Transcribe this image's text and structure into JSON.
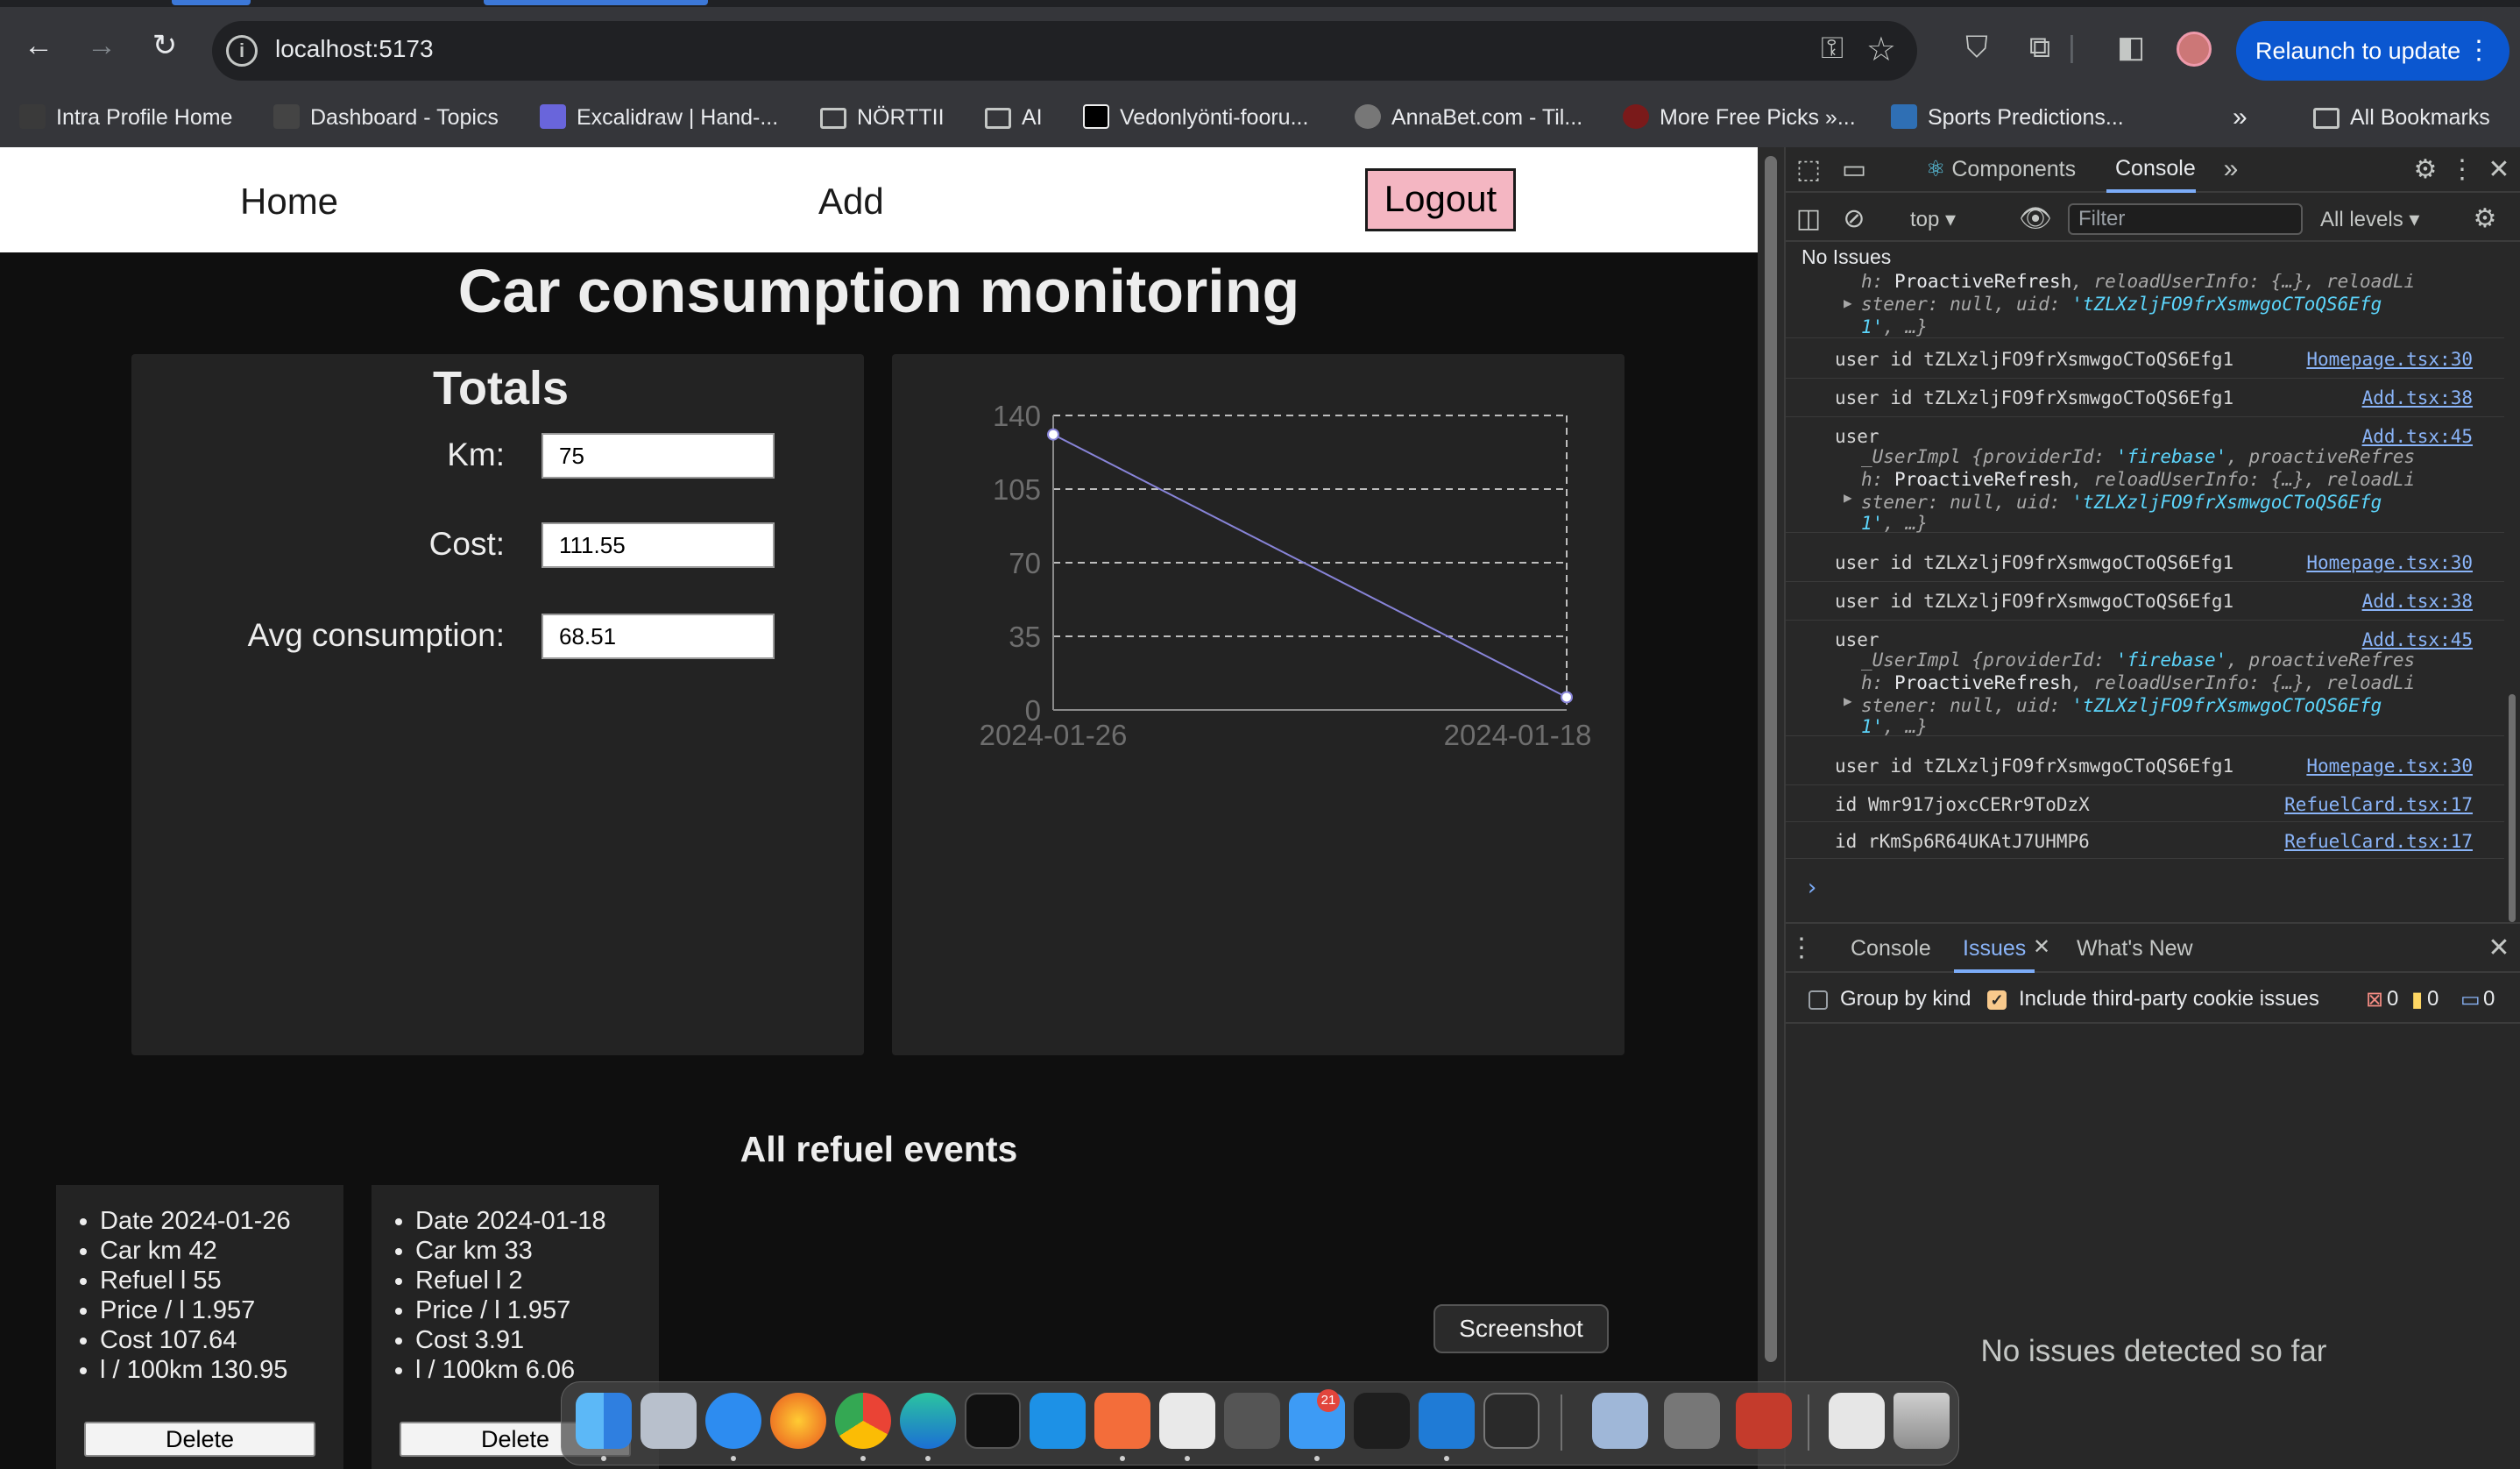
{
  "browser": {
    "url": "localhost:5173",
    "relaunch_label": "Relaunch to update",
    "bookmarks": [
      {
        "label": "Intra Profile Home",
        "icon": "4s-logo-icon"
      },
      {
        "label": "Dashboard - Topics",
        "icon": "forum-icon"
      },
      {
        "label": "Excalidraw | Hand-...",
        "icon": "excalidraw-icon"
      },
      {
        "label": "NÖRTTII",
        "icon": "folder-icon"
      },
      {
        "label": "AI",
        "icon": "folder-icon"
      },
      {
        "label": "Vedonlyönti-fooru...",
        "icon": "terminal-icon"
      },
      {
        "label": "AnnaBet.com - Til...",
        "icon": "annabet-icon"
      },
      {
        "label": "More Free Picks »...",
        "icon": "picks-icon"
      },
      {
        "label": "Sports Predictions...",
        "icon": "predictions-icon"
      }
    ],
    "all_bookmarks_label": "All Bookmarks"
  },
  "app": {
    "nav": {
      "home": "Home",
      "add": "Add",
      "logout": "Logout"
    },
    "title": "Car consumption monitoring",
    "totals": {
      "title": "Totals",
      "km_label": "Km:",
      "km_value": "75",
      "cost_label": "Cost:",
      "cost_value": "111.55",
      "avg_label": "Avg consumption:",
      "avg_value": "68.51"
    },
    "events_title": "All refuel events",
    "events": [
      {
        "items": [
          "Date 2024-01-26",
          "Car km 42",
          "Refuel l 55",
          "Price / l 1.957",
          "Cost 107.64",
          "l / 100km 130.95"
        ],
        "delete_label": "Delete"
      },
      {
        "items": [
          "Date 2024-01-18",
          "Car km 33",
          "Refuel l 2",
          "Price / l 1.957",
          "Cost 3.91",
          "l / 100km 6.06"
        ],
        "delete_label": "Delete"
      }
    ]
  },
  "chart_data": {
    "type": "line",
    "x": [
      "2024-01-26",
      "2024-01-18"
    ],
    "series": [
      {
        "values": [
          130.95,
          6.06
        ],
        "color": "#8884d8"
      }
    ],
    "ylim": [
      0,
      140
    ],
    "yticks": [
      "0",
      "35",
      "70",
      "105",
      "140"
    ],
    "grid": "dashed",
    "title": "",
    "xlabel": "",
    "ylabel": ""
  },
  "devtools": {
    "tabs": [
      "Components",
      "Console"
    ],
    "context": "top",
    "filter_placeholder": "Filter",
    "levels": "All levels ▾",
    "no_issues": "No Issues",
    "logs": [
      {
        "text": "user id tZLXzljFO9frXsmwgoCToQS6Efg1",
        "src": "Homepage.tsx:30"
      },
      {
        "text": "user id tZLXzljFO9frXsmwgoCToQS6Efg1",
        "src": "Add.tsx:38"
      },
      {
        "text": "user",
        "src": "Add.tsx:45"
      },
      {
        "text": "user id tZLXzljFO9frXsmwgoCToQS6Efg1",
        "src": "Homepage.tsx:30"
      },
      {
        "text": "user id tZLXzljFO9frXsmwgoCToQS6Efg1",
        "src": "Add.tsx:38"
      },
      {
        "text": "user",
        "src": "Add.tsx:45"
      },
      {
        "text": "user id tZLXzljFO9frXsmwgoCToQS6Efg1",
        "src": "Homepage.tsx:30"
      },
      {
        "text": "id Wmr917joxcCERr9ToDzX",
        "src": "RefuelCard.tsx:17"
      },
      {
        "text": "id rKmSp6R64UKAtJ7UHMP6",
        "src": "RefuelCard.tsx:17"
      }
    ],
    "obj": {
      "line1a": "_UserImpl {providerId: ",
      "line1b": "'firebase'",
      "line1c": ", proactiveRefres",
      "line2a": "h: ",
      "line2b": "ProactiveRefresh",
      "line2c": ", reloadUserInfo: {…}, reloadLi",
      "line3a": "stener: null, uid: ",
      "line3b": "'tZLXzljFO9frXsmwgoCToQS6Efg",
      "line4": "1'",
      "line4b": ", …}"
    },
    "drawer_tabs": [
      "Console",
      "Issues",
      "What's New"
    ],
    "group_by_kind": "Group by kind",
    "include_third_party": "Include third-party cookie issues",
    "counts": [
      "0",
      "0",
      "0"
    ],
    "no_issues_big": "No issues detected so far"
  },
  "dock": {
    "tooltip": "Screenshot",
    "mail_badge": "21"
  }
}
